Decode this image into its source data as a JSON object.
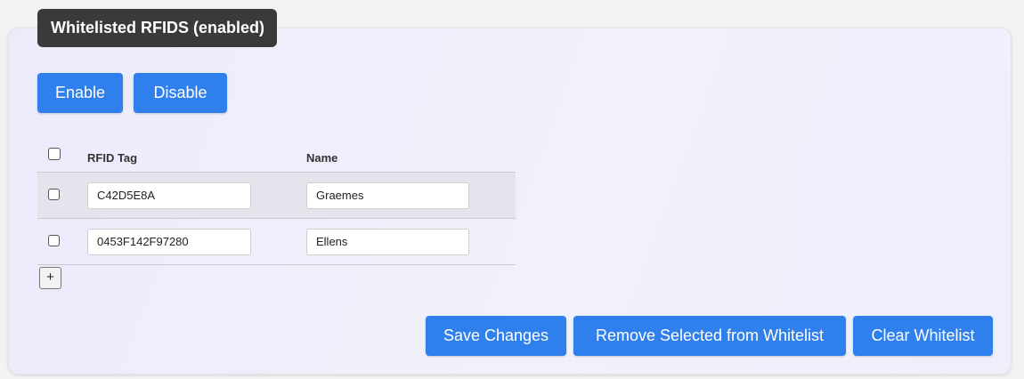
{
  "panel": {
    "title": "Whitelisted RFIDS (enabled)"
  },
  "toolbar": {
    "enable_label": "Enable",
    "disable_label": "Disable"
  },
  "table": {
    "headers": {
      "tag": "RFID Tag",
      "name": "Name"
    },
    "rows": [
      {
        "tag": "C42D5E8A",
        "name": "Graemes",
        "checked": false
      },
      {
        "tag": "0453F142F97280",
        "name": "Ellens",
        "checked": false
      }
    ]
  },
  "add_row_label": "+",
  "actions": {
    "save_label": "Save Changes",
    "remove_label": "Remove Selected from Whitelist",
    "clear_label": "Clear Whitelist"
  },
  "colors": {
    "accent": "#2f80ed",
    "title_bg": "#3a3a3a",
    "panel_bg": "#ededfc"
  }
}
